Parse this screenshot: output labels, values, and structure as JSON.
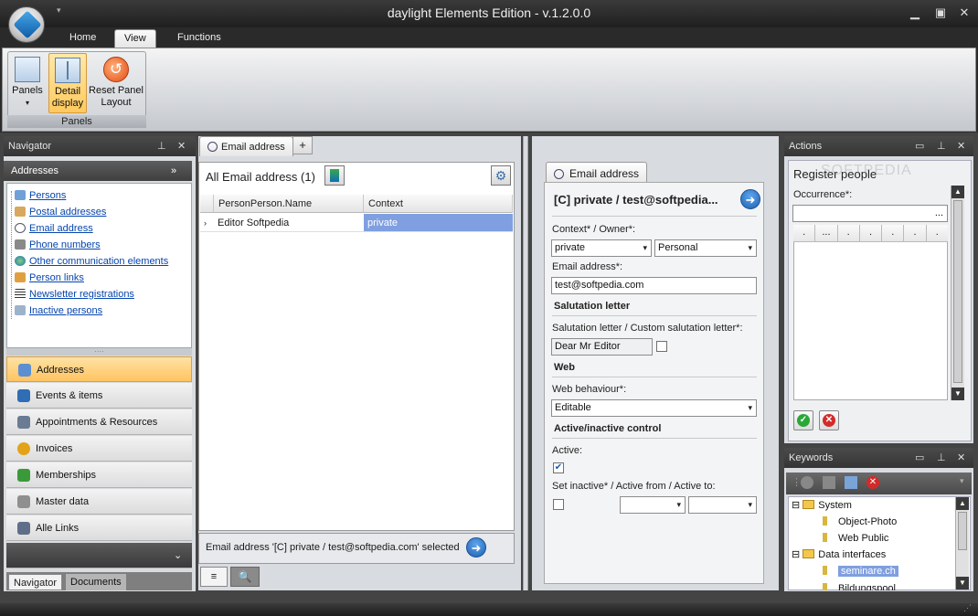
{
  "window": {
    "title": "daylight Elements Edition - v.1.2.0.0"
  },
  "ribbon": {
    "tabs": [
      {
        "label": "Home"
      },
      {
        "label": "View"
      },
      {
        "label": "Functions"
      }
    ],
    "group_label": "Panels",
    "buttons": [
      {
        "label": "Panels"
      },
      {
        "label": "Detail display"
      },
      {
        "label": "Reset Panel Layout"
      }
    ]
  },
  "navigator": {
    "title": "Navigator",
    "section_title": "Addresses",
    "links": [
      {
        "label": "Persons",
        "icon": "persons-icon"
      },
      {
        "label": "Postal addresses",
        "icon": "postal-icon"
      },
      {
        "label": "Email address",
        "icon": "email-icon"
      },
      {
        "label": "Phone numbers",
        "icon": "phone-icon"
      },
      {
        "label": "Other communication elements",
        "icon": "globe-icon"
      },
      {
        "label": "Person links",
        "icon": "person-link-icon"
      },
      {
        "label": "Newsletter registrations",
        "icon": "list-icon"
      },
      {
        "label": "Inactive persons",
        "icon": "inactive-icon"
      }
    ],
    "modules": [
      {
        "label": "Addresses",
        "color": "#5b8fd1"
      },
      {
        "label": "Events & items",
        "color": "#2f6db5"
      },
      {
        "label": "Appointments & Resources",
        "color": "#6a7b94"
      },
      {
        "label": "Invoices",
        "color": "#e3a316"
      },
      {
        "label": "Memberships",
        "color": "#3a9a3a"
      },
      {
        "label": "Master data",
        "color": "#8f8f8f"
      },
      {
        "label": "Alle Links",
        "color": "#5f6f8a"
      }
    ],
    "bottom_tabs": [
      {
        "label": "Navigator"
      },
      {
        "label": "Documents"
      }
    ]
  },
  "center": {
    "tab_label": "Email address",
    "add_tab": "+",
    "list_title": "All Email address (1)",
    "columns": [
      "PersonPerson.Name",
      "Context"
    ],
    "rows": [
      {
        "name": "Editor Softpedia",
        "context": "private"
      }
    ],
    "status_text": "Email address '[C] private / test@softpedia.com' selected",
    "bottom_tabs": [
      "≡",
      "🔍"
    ]
  },
  "detail": {
    "tab_label": "Email address",
    "heading": "[C] private / test@softpedia...",
    "context_owner_label": "Context* / Owner*:",
    "context_value": "private",
    "owner_value": "Personal",
    "email_label": "Email address*:",
    "email_value": "test@softpedia.com",
    "salutation_section": "Salutation letter",
    "salutation_label": "Salutation letter / Custom salutation letter*:",
    "salutation_value": "Dear Mr Editor",
    "web_section": "Web",
    "web_label": "Web behaviour*:",
    "web_value": "Editable",
    "active_section": "Active/inactive control",
    "active_label": "Active:",
    "set_inactive_label": "Set inactive* / Active from / Active to:"
  },
  "actions": {
    "title": "Actions",
    "register_label": "Register people",
    "occurrence_label": "Occurrence*:",
    "occurrence_btn": "...",
    "grid_cells": [
      ".",
      "...",
      ".",
      ".",
      ".",
      ".",
      "."
    ]
  },
  "keywords": {
    "title": "Keywords",
    "tree": [
      {
        "label": "System",
        "type": "folder",
        "level": 0,
        "toggle": "⊟"
      },
      {
        "label": "Object-Photo",
        "type": "key",
        "level": 1
      },
      {
        "label": "Web Public",
        "type": "key",
        "level": 1
      },
      {
        "label": "Data interfaces",
        "type": "folder",
        "level": 0,
        "toggle": "⊟"
      },
      {
        "label": "seminare.ch",
        "type": "key",
        "level": 1,
        "selected": true
      },
      {
        "label": "Bildungspool",
        "type": "key",
        "level": 1
      }
    ]
  },
  "watermark": "SOFTPEDIA"
}
